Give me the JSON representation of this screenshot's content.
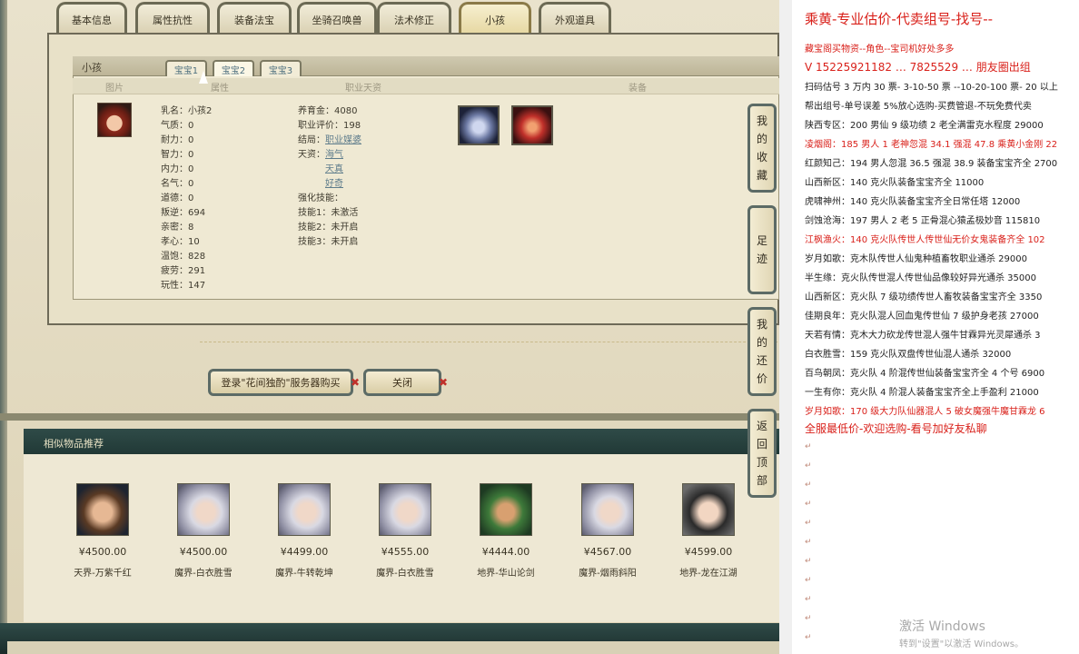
{
  "tabs": [
    "基本信息",
    "属性抗性",
    "装备法宝",
    "坐骑召唤兽",
    "法术修正",
    "小孩",
    "外观道具"
  ],
  "active_tab": "小孩",
  "kid_panel": {
    "title": "小孩",
    "subtabs": [
      "宝宝1",
      "宝宝2",
      "宝宝3"
    ],
    "columns": [
      "图片",
      "属性",
      "职业天资",
      "装备"
    ],
    "stats_left": [
      "乳名：小孩2",
      "气质：0",
      "耐力：0",
      "智力：0",
      "内力：0",
      "名气：0",
      "道德：0",
      "叛逆：694",
      "亲密：8",
      "孝心：10",
      "温饱：828",
      "疲劳：291",
      "玩性：147"
    ],
    "stats_right": [
      "养育金：4080",
      "职业评价：198",
      "结局：",
      "天资：",
      "强化技能：",
      "技能1：未激活",
      "技能2：未开启",
      "技能3：未开启"
    ],
    "ending_link": "职业媒婆",
    "talents": [
      "海气",
      "天真",
      "好奇"
    ]
  },
  "buttons": {
    "buy": "登录\"花间独酌\"服务器购买",
    "close": "关闭",
    "x": "✖"
  },
  "similar": {
    "title": "相似物品推荐",
    "items": [
      {
        "price": "¥4500.00",
        "name": "天界-万紫千红"
      },
      {
        "price": "¥4500.00",
        "name": "魔界-白衣胜雪"
      },
      {
        "price": "¥4499.00",
        "name": "魔界-牛转乾坤"
      },
      {
        "price": "¥4555.00",
        "name": "魔界-白衣胜雪"
      },
      {
        "price": "¥4444.00",
        "name": "地界-华山论剑"
      },
      {
        "price": "¥4567.00",
        "name": "魔界-烟雨斜阳"
      },
      {
        "price": "¥4599.00",
        "name": "地界-龙在江湖"
      }
    ]
  },
  "sidenav": [
    {
      "label": [
        "我",
        "的",
        "收",
        "藏"
      ]
    },
    {
      "label": [
        "足",
        "迹"
      ]
    },
    {
      "label": [
        "我",
        "的",
        "还",
        "价"
      ]
    },
    {
      "label": [
        "返",
        "回",
        "顶",
        "部"
      ]
    }
  ],
  "doc": {
    "lines": [
      {
        "text": "乘黄-专业估价-代卖组号-找号--",
        "style": "big"
      },
      {
        "text": "藏宝阁买物资--角色--宝司机好处多多",
        "style": "red"
      },
      {
        "text": "V 15225921182 … 7825529 … 朋友圈出组",
        "style": "mid"
      },
      {
        "text": "扫码估号 3 万内 30 票- 3-10-50 票 --10-20-100 票- 20 以上",
        "style": ""
      },
      {
        "text": "帮出组号-单号误差 5%放心选购-买费管退-不玩免费代卖",
        "style": ""
      },
      {
        "text": "陕西专区：200 男仙 9 级功绩 2 老全满雷克水程度 29000",
        "style": ""
      },
      {
        "text": "凌烟阁：185 男人 1 老神忽混 34.1 强混 47.8 乘黄小金刚 22",
        "style": "red"
      },
      {
        "text": "红颜知己：194 男人忽混 36.5 强混 38.9 装备宝宝齐全 2700",
        "style": ""
      },
      {
        "text": "山西新区：140 克火队装备宝宝齐全 11000",
        "style": ""
      },
      {
        "text": "虎啸神州：140 克火队装备宝宝齐全日常任塔 12000",
        "style": ""
      },
      {
        "text": "剑蚀沧海：197 男人 2 老 5 正骨混心猿孟极妙音 115810",
        "style": ""
      },
      {
        "text": "江枫渔火：140 克火队传世人传世仙无价女鬼装备齐全 102",
        "style": "red"
      },
      {
        "text": "岁月如歌：克木队传世人仙鬼种植畜牧职业通杀 29000",
        "style": ""
      },
      {
        "text": "半生缘：克火队传世混人传世仙品像较好异光通杀 35000",
        "style": ""
      },
      {
        "text": "山西新区：克火队 7 级功绩传世人畜牧装备宝宝齐全 3350",
        "style": ""
      },
      {
        "text": "佳期良年：克火队混人回血鬼传世仙 7 级护身老孩 27000",
        "style": ""
      },
      {
        "text": "天若有情：克木大力砍龙传世混人强牛甘霖异光灵犀通杀 3",
        "style": ""
      },
      {
        "text": "白衣胜雪：159 克火队双盘传世仙混人通杀 32000",
        "style": ""
      },
      {
        "text": "百鸟朝凤：克火队 4 阶混传世仙装备宝宝齐全 4 个号 6900",
        "style": ""
      },
      {
        "text": "一生有你：克火队 4 阶混人装备宝宝齐全上手盈利 21000",
        "style": ""
      },
      {
        "text": "岁月如歌：170 级大力队仙器混人 5 破女魔强牛魔甘霖龙 6",
        "style": "red"
      },
      {
        "text": "全服最低价-欢迎选购-看号加好友私聊",
        "style": "mid"
      }
    ],
    "watermark_1": "激活 Windows",
    "watermark_2": "转到\"设置\"以激活 Windows。"
  }
}
